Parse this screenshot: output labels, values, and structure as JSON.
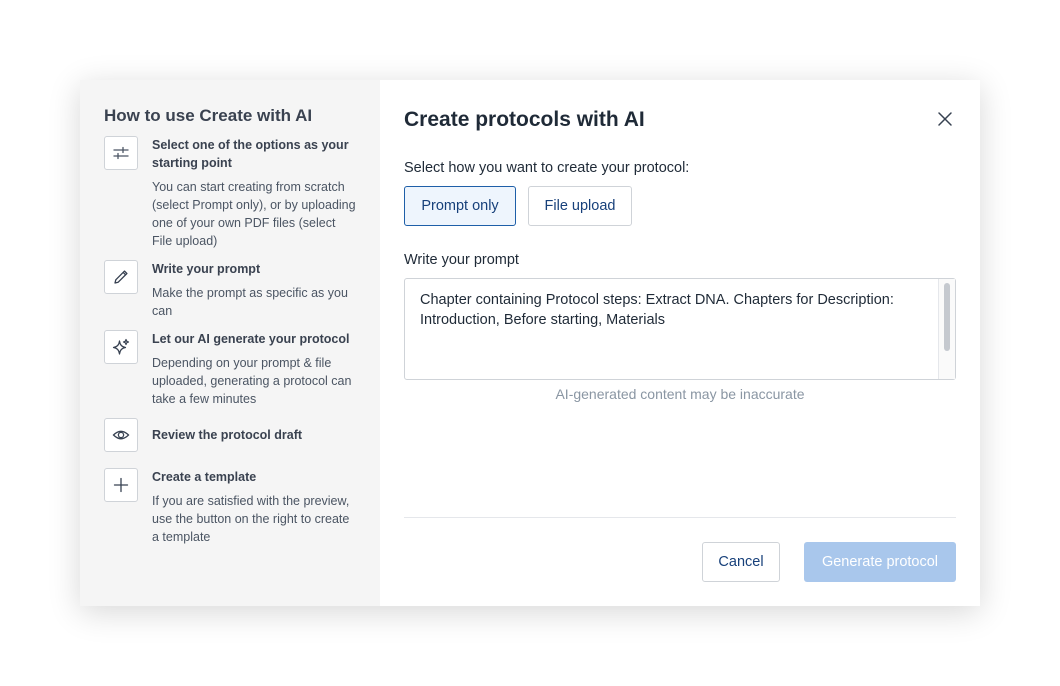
{
  "sidebar": {
    "title": "How to use Create with AI",
    "steps": [
      {
        "icon": "sliders-icon",
        "heading": "Select one of the options as your starting point",
        "text": "You can start creating from scratch (select Prompt only), or by uploading one of your own PDF files (select File upload)"
      },
      {
        "icon": "pencil-icon",
        "heading": "Write your prompt",
        "text": "Make the prompt as specific as you can"
      },
      {
        "icon": "sparkle-icon",
        "heading": "Let our AI generate your protocol",
        "text": "Depending on your prompt & file uploaded, generating a protocol can take a few minutes"
      },
      {
        "icon": "eye-icon",
        "heading": "Review the protocol draft",
        "text": ""
      },
      {
        "icon": "plus-icon",
        "heading": "Create a template",
        "text": "If you are satisfied with the preview, use the button on the right to create a template"
      }
    ]
  },
  "main": {
    "title": "Create protocols with AI",
    "select_label": "Select how you want to create your protocol:",
    "options": [
      {
        "label": "Prompt only",
        "selected": true
      },
      {
        "label": "File upload",
        "selected": false
      }
    ],
    "prompt_label": "Write your prompt",
    "prompt_value": "Chapter containing Protocol steps: Extract DNA. Chapters for Description: Introduction, Before starting, Materials",
    "hint": "AI-generated content may be inaccurate",
    "cancel_label": "Cancel",
    "generate_label": "Generate protocol",
    "generate_disabled": true
  },
  "colors": {
    "accent": "#1e5fa8",
    "link_text": "#17407a",
    "disabled_button": "#a9c7ec",
    "sidebar_bg": "#f5f5f5"
  }
}
